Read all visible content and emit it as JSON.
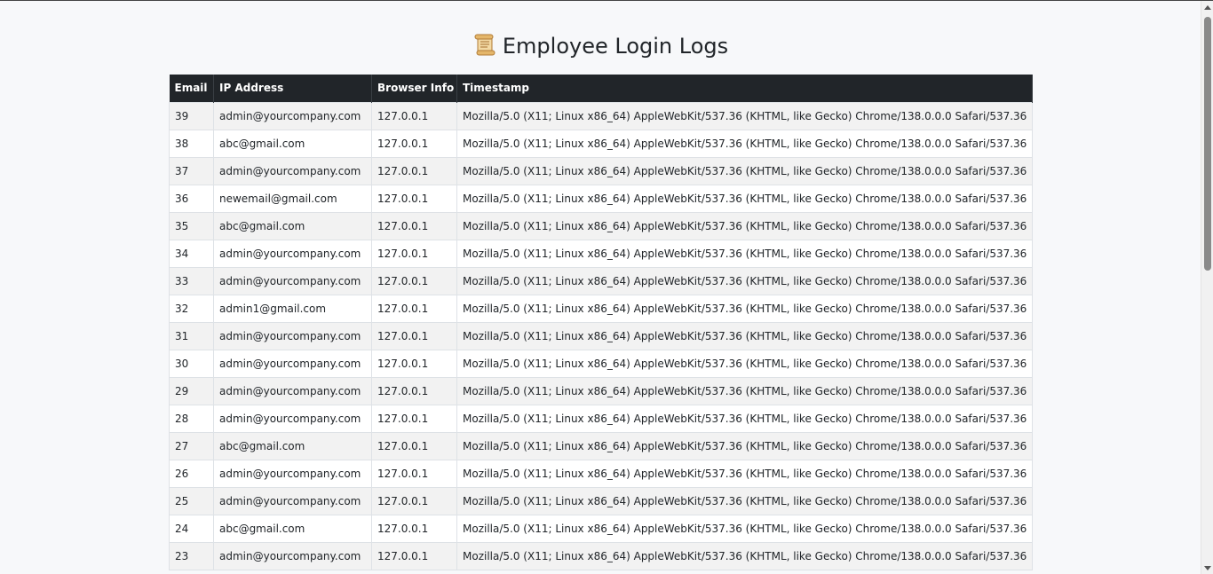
{
  "page": {
    "title": "Employee Login Logs",
    "title_icon": "scroll-icon"
  },
  "table": {
    "headers": [
      "Email",
      "IP Address",
      "Browser Info",
      "Timestamp"
    ],
    "rows": [
      [
        "39",
        "admin@yourcompany.com",
        "127.0.0.1",
        "Mozilla/5.0 (X11; Linux x86_64) AppleWebKit/537.36 (KHTML, like Gecko) Chrome/138.0.0.0 Safari/537.36"
      ],
      [
        "38",
        "abc@gmail.com",
        "127.0.0.1",
        "Mozilla/5.0 (X11; Linux x86_64) AppleWebKit/537.36 (KHTML, like Gecko) Chrome/138.0.0.0 Safari/537.36"
      ],
      [
        "37",
        "admin@yourcompany.com",
        "127.0.0.1",
        "Mozilla/5.0 (X11; Linux x86_64) AppleWebKit/537.36 (KHTML, like Gecko) Chrome/138.0.0.0 Safari/537.36"
      ],
      [
        "36",
        "newemail@gmail.com",
        "127.0.0.1",
        "Mozilla/5.0 (X11; Linux x86_64) AppleWebKit/537.36 (KHTML, like Gecko) Chrome/138.0.0.0 Safari/537.36"
      ],
      [
        "35",
        "abc@gmail.com",
        "127.0.0.1",
        "Mozilla/5.0 (X11; Linux x86_64) AppleWebKit/537.36 (KHTML, like Gecko) Chrome/138.0.0.0 Safari/537.36"
      ],
      [
        "34",
        "admin@yourcompany.com",
        "127.0.0.1",
        "Mozilla/5.0 (X11; Linux x86_64) AppleWebKit/537.36 (KHTML, like Gecko) Chrome/138.0.0.0 Safari/537.36"
      ],
      [
        "33",
        "admin@yourcompany.com",
        "127.0.0.1",
        "Mozilla/5.0 (X11; Linux x86_64) AppleWebKit/537.36 (KHTML, like Gecko) Chrome/138.0.0.0 Safari/537.36"
      ],
      [
        "32",
        "admin1@gmail.com",
        "127.0.0.1",
        "Mozilla/5.0 (X11; Linux x86_64) AppleWebKit/537.36 (KHTML, like Gecko) Chrome/138.0.0.0 Safari/537.36"
      ],
      [
        "31",
        "admin@yourcompany.com",
        "127.0.0.1",
        "Mozilla/5.0 (X11; Linux x86_64) AppleWebKit/537.36 (KHTML, like Gecko) Chrome/138.0.0.0 Safari/537.36"
      ],
      [
        "30",
        "admin@yourcompany.com",
        "127.0.0.1",
        "Mozilla/5.0 (X11; Linux x86_64) AppleWebKit/537.36 (KHTML, like Gecko) Chrome/138.0.0.0 Safari/537.36"
      ],
      [
        "29",
        "admin@yourcompany.com",
        "127.0.0.1",
        "Mozilla/5.0 (X11; Linux x86_64) AppleWebKit/537.36 (KHTML, like Gecko) Chrome/138.0.0.0 Safari/537.36"
      ],
      [
        "28",
        "admin@yourcompany.com",
        "127.0.0.1",
        "Mozilla/5.0 (X11; Linux x86_64) AppleWebKit/537.36 (KHTML, like Gecko) Chrome/138.0.0.0 Safari/537.36"
      ],
      [
        "27",
        "abc@gmail.com",
        "127.0.0.1",
        "Mozilla/5.0 (X11; Linux x86_64) AppleWebKit/537.36 (KHTML, like Gecko) Chrome/138.0.0.0 Safari/537.36"
      ],
      [
        "26",
        "admin@yourcompany.com",
        "127.0.0.1",
        "Mozilla/5.0 (X11; Linux x86_64) AppleWebKit/537.36 (KHTML, like Gecko) Chrome/138.0.0.0 Safari/537.36"
      ],
      [
        "25",
        "admin@yourcompany.com",
        "127.0.0.1",
        "Mozilla/5.0 (X11; Linux x86_64) AppleWebKit/537.36 (KHTML, like Gecko) Chrome/138.0.0.0 Safari/537.36"
      ],
      [
        "24",
        "abc@gmail.com",
        "127.0.0.1",
        "Mozilla/5.0 (X11; Linux x86_64) AppleWebKit/537.36 (KHTML, like Gecko) Chrome/138.0.0.0 Safari/537.36"
      ],
      [
        "23",
        "admin@yourcompany.com",
        "127.0.0.1",
        "Mozilla/5.0 (X11; Linux x86_64) AppleWebKit/537.36 (KHTML, like Gecko) Chrome/138.0.0.0 Safari/537.36"
      ]
    ]
  },
  "colors": {
    "header_bg": "#212529",
    "header_text": "#ffffff",
    "row_striped": "#f2f2f2",
    "row_plain": "#ffffff",
    "page_bg": "#f7f8fa"
  }
}
